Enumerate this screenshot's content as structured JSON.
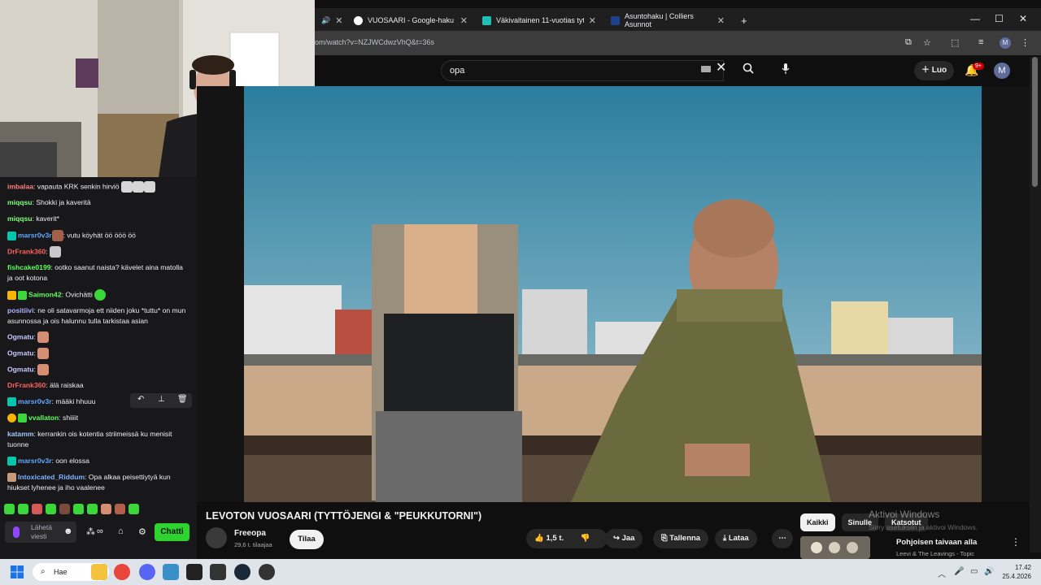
{
  "browser": {
    "tabs": [
      {
        "title": "",
        "active": false,
        "audio": true
      },
      {
        "title": "VUOSAARI - Google-haku",
        "active": false
      },
      {
        "title": "Väkivaltainen 11-vuotias tyttö c",
        "active": false
      },
      {
        "title": "Asuntohaku | Colliers Asunnot",
        "active": false
      }
    ],
    "new_tab": "+",
    "url": "om/watch?v=NZJWCdwzVhQ&t=36s",
    "profile_initial": "M"
  },
  "youtube": {
    "search_value": "opa",
    "create_label": "Luo",
    "notifications": "9+",
    "avatar_initial": "M",
    "video_title": "LEVOTON VUOSAARI (TYTTÖJENGI & \"PEUKKUTORNI\")",
    "channel_name": "Freeopa",
    "channel_subs": "29,6 t. tilaajaa",
    "subscribe_label": "Tilaa",
    "likes": "1,5 t.",
    "share_label": "Jaa",
    "save_label": "Tallenna",
    "download_label": "Lataa",
    "chips": [
      "Kaikki",
      "Sinulle",
      "Katsotut"
    ],
    "reco_title": "Pohjoisen taivaan alla",
    "reco_channel": "Leevi & The Leavings - Topic",
    "watermark_title": "Aktivoi Windows",
    "watermark_sub": "Siirry asetuksiin ja aktivoi Windows."
  },
  "chat": {
    "messages": [
      {
        "user": "imbalaa",
        "color": "#ff7f7f",
        "text": ": vapauta KRK senkin hirviö"
      },
      {
        "user": "miqqsu",
        "color": "#7fff7f",
        "text": ": Shokki ja kaveritä"
      },
      {
        "user": "miqqsu",
        "color": "#7fff7f",
        "text": ": kaverit*"
      },
      {
        "user": "marsr0v3r",
        "color": "#5fa8ff",
        "text": ": vutu köyhät öö ööö öö"
      },
      {
        "user": "DrFrank360",
        "color": "#ff6060",
        "text": ":"
      },
      {
        "user": "fishcake0199",
        "color": "#5fff5f",
        "text": ": ootko saanut naista? kävelet aina matolla ja oot kotona"
      },
      {
        "user": "Saimon42",
        "color": "#5fff5f",
        "text": ": Ovichätti"
      },
      {
        "user": "positiivi",
        "color": "#b0b0ff",
        "text": ": ne oli satavarmoja ett niiden joku *tuttu* on mun asunnossa ja ois halunnu tulla tarkistaa asian"
      },
      {
        "user": "Ogmatu",
        "color": "#c7c7ff",
        "text": ":"
      },
      {
        "user": "Ogmatu",
        "color": "#c7c7ff",
        "text": ":"
      },
      {
        "user": "Ogmatu",
        "color": "#c7c7ff",
        "text": ":"
      },
      {
        "user": "DrFrank360",
        "color": "#ff6060",
        "text": ": älä raiskaa"
      },
      {
        "user": "marsr0v3r",
        "color": "#5fa8ff",
        "text": ": määki hhuuu"
      },
      {
        "user": "vvallaton",
        "color": "#5fff5f",
        "text": ": shiiiit"
      },
      {
        "user": "katamm",
        "color": "#9fc8ff",
        "text": ": kerrankin ois kotentia striimeissä ku menisit tuonne"
      },
      {
        "user": "marsr0v3r",
        "color": "#5fa8ff",
        "text": ": oon elossa"
      },
      {
        "user": "Intoxicated_Riddum",
        "color": "#7fb2ff",
        "text": ": Opa alkaa peisettiytyä kun hiukset lyhenee ja iho vaalenee"
      }
    ],
    "input_placeholder": "Lähetä viesti",
    "send_label": "Chatti"
  },
  "taskbar": {
    "search_label": "Hae",
    "time": "17.42",
    "date": "25.4.2026"
  }
}
